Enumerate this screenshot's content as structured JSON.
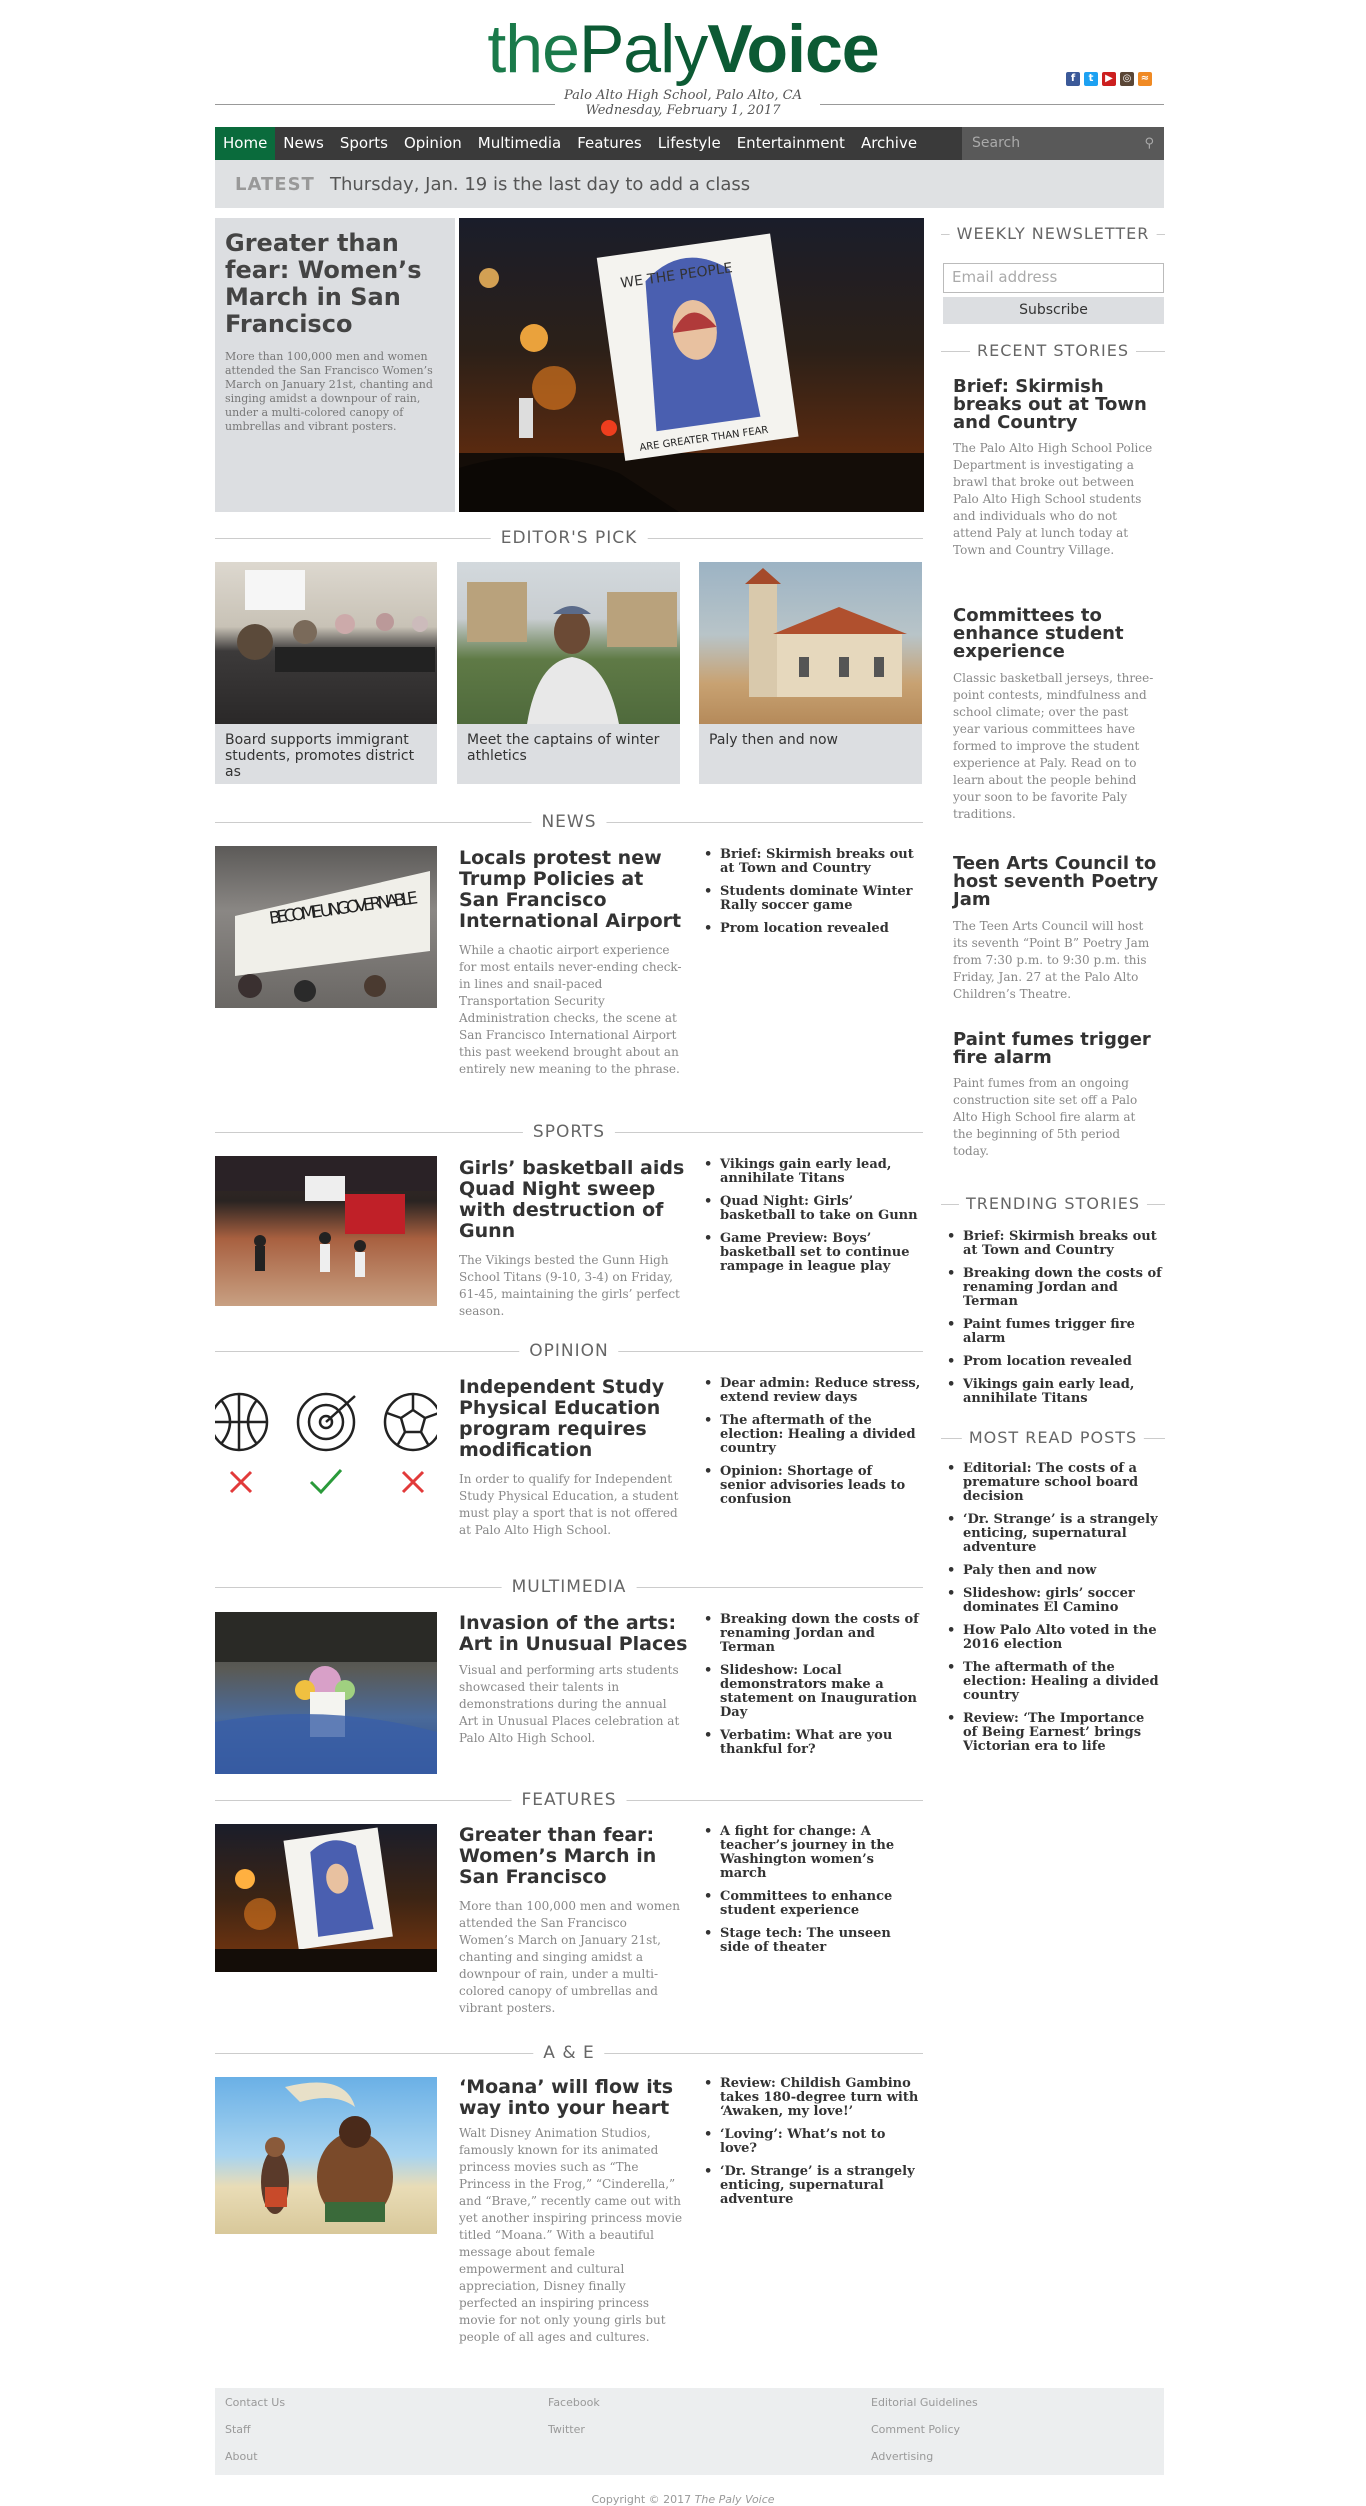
{
  "header": {
    "logo_the": "the",
    "logo_paly": "Paly",
    "logo_voice": "Voice",
    "school": "Palo Alto High School, Palo Alto, CA",
    "date": "Wednesday, February 1, 2017",
    "social_icons": [
      "facebook-icon",
      "twitter-icon",
      "youtube-icon",
      "instagram-icon",
      "rss-icon"
    ]
  },
  "nav": {
    "items": [
      "Home",
      "News",
      "Sports",
      "Opinion",
      "Multimedia",
      "Features",
      "Lifestyle",
      "Entertainment",
      "Archive"
    ],
    "active": "Home",
    "search_placeholder": "Search"
  },
  "latest": {
    "label": "LATEST",
    "text": "Thursday, Jan. 19 is the last day to add a class"
  },
  "hero": {
    "title": "Greater than fear: Women’s March in San Francisco",
    "summary": "More than 100,000 men and women attended the San Francisco Women’s March on January 21st, chanting and singing amidst a downpour of rain, under a multi-colored canopy of umbrellas and vibrant posters.",
    "sign_top": "WE THE PEOPLE",
    "sign_bottom": "ARE GREATER THAN FEAR"
  },
  "editors_pick": {
    "heading": "EDITOR'S PICK",
    "items": [
      {
        "caption": "Board supports immigrant students, promotes district as"
      },
      {
        "caption": "Meet the captains of winter athletics"
      },
      {
        "caption": "Paly then and now"
      }
    ]
  },
  "sections": [
    {
      "heading": "NEWS",
      "title": "Locals protest new Trump Policies at San Francisco International Airport",
      "summary": "While a chaotic airport experience for most entails never-ending check-in lines and snail-paced Transportation Security Administration checks, the scene at San Francisco International Airport this past weekend brought about an entirely new meaning to the phrase.",
      "banner_text": "BECOME UNGOVERNABLE",
      "links": [
        "Brief: Skirmish breaks out at Town and Country",
        "Students dominate Winter Rally soccer game",
        "Prom location revealed"
      ]
    },
    {
      "heading": "SPORTS",
      "title": "Girls’ basketball aids Quad Night sweep with destruction of Gunn",
      "summary": "The Vikings bested the Gunn High School Titans (9-10, 3-4) on Friday, 61-45, maintaining the girls’ perfect season.",
      "links": [
        "Vikings gain early lead, annihilate Titans",
        "Quad Night: Girls’ basketball to take on Gunn",
        "Game Preview: Boys’ basketball set to continue rampage in league play"
      ]
    },
    {
      "heading": "OPINION",
      "title": "Independent Study Physical Education program requires modification",
      "summary": "In order to qualify for Independent Study Physical Education, a student must play a sport that is not offered at Palo Alto High School.",
      "links": [
        "Dear admin: Reduce stress, extend review days",
        "The aftermath of the election: Healing a divided country",
        "Opinion: Shortage of senior advisories leads to confusion"
      ]
    },
    {
      "heading": "MULTIMEDIA",
      "title": "Invasion of the arts: Art in Unusual Places",
      "summary": "Visual and performing arts students showcased their talents in demonstrations during the annual Art in Unusual Places celebration at Palo Alto High School.",
      "links": [
        "Breaking down the costs of renaming Jordan and Terman",
        "Slideshow: Local demonstrators make a statement on Inauguration Day",
        "Verbatim: What are you thankful for?"
      ]
    },
    {
      "heading": "FEATURES",
      "title": "Greater than fear: Women’s March in San Francisco",
      "summary": "More than 100,000 men and women attended the San Francisco Women’s March on January 21st, chanting and singing amidst a downpour of rain, under a multi-colored canopy of umbrellas and vibrant posters.",
      "links": [
        "A fight for change: A teacher’s journey in the Washington women’s march",
        "Committees to enhance student experience",
        "Stage tech: The unseen side of theater"
      ]
    },
    {
      "heading": "A & E",
      "title": "‘Moana’ will flow its way into your heart",
      "summary": "Walt Disney Animation Studios, famously known for its animated princess movies such as “The Princess in the Frog,” “Cinderella,” and “Brave,” recently came out with yet another inspiring princess movie titled “Moana.” With a beautiful message about female empowerment and cultural appreciation, Disney finally perfected an inspiring princess movie for not only young girls but people of all ages and cultures.",
      "links": [
        "Review: Childish Gambino takes 180-degree turn with ‘Awaken, my love!’",
        "‘Loving’: What’s not to love?",
        "‘Dr. Strange’ is a strangely enticing, supernatural adventure"
      ]
    }
  ],
  "sidebar": {
    "newsletter": {
      "heading": "WEEKLY NEWSLETTER",
      "email_placeholder": "Email address",
      "subscribe_label": "Subscribe"
    },
    "recent": {
      "heading": "RECENT STORIES",
      "items": [
        {
          "title": "Brief: Skirmish breaks out at Town and Country",
          "text": "The Palo Alto High School Police Department is investigating a brawl that broke out between Palo Alto High School students and individuals who do not attend Paly at lunch today at Town and Country Village."
        },
        {
          "title": "Committees to enhance student experience",
          "text": "Classic basketball jerseys, three-point contests, mindfulness and school climate; over the past year various committees have formed to improve the student experience at Paly. Read on to learn about the people behind your soon to be favorite Paly traditions."
        },
        {
          "title": "Teen Arts Council to host seventh Poetry Jam",
          "text": "The Teen Arts Council will host its seventh “Point B” Poetry Jam from 7:30 p.m. to 9:30 p.m. this Friday, Jan. 27 at the Palo Alto Children’s Theatre."
        },
        {
          "title": "Paint fumes trigger fire alarm",
          "text": "Paint fumes from an ongoing construction site set off a Palo Alto High School fire alarm at the beginning of 5th period today."
        }
      ]
    },
    "trending": {
      "heading": "TRENDING STORIES",
      "items": [
        "Brief: Skirmish breaks out at Town and Country",
        "Breaking down the costs of renaming Jordan and Terman",
        "Paint fumes trigger fire alarm",
        "Prom location revealed",
        "Vikings gain early lead, annihilate Titans"
      ]
    },
    "most_read": {
      "heading": "MOST READ POSTS",
      "items": [
        "Editorial: The costs of a premature school board decision",
        "‘Dr. Strange’ is a strangely enticing, supernatural adventure",
        "Paly then and now",
        "Slideshow: girls’ soccer dominates El Camino",
        "How Palo Alto voted in the 2016 election",
        "The aftermath of the election: Healing a divided country",
        "Review: ‘The Importance of Being Earnest’ brings Victorian era to life"
      ]
    }
  },
  "footer": {
    "col1": [
      "Contact Us",
      "Staff",
      "About"
    ],
    "col2": [
      "Facebook",
      "Twitter"
    ],
    "col3": [
      "Editorial Guidelines",
      "Comment Policy",
      "Advertising"
    ],
    "copyright_prefix": "Copyright © 2017 ",
    "copyright_name": "The Paly Voice"
  }
}
